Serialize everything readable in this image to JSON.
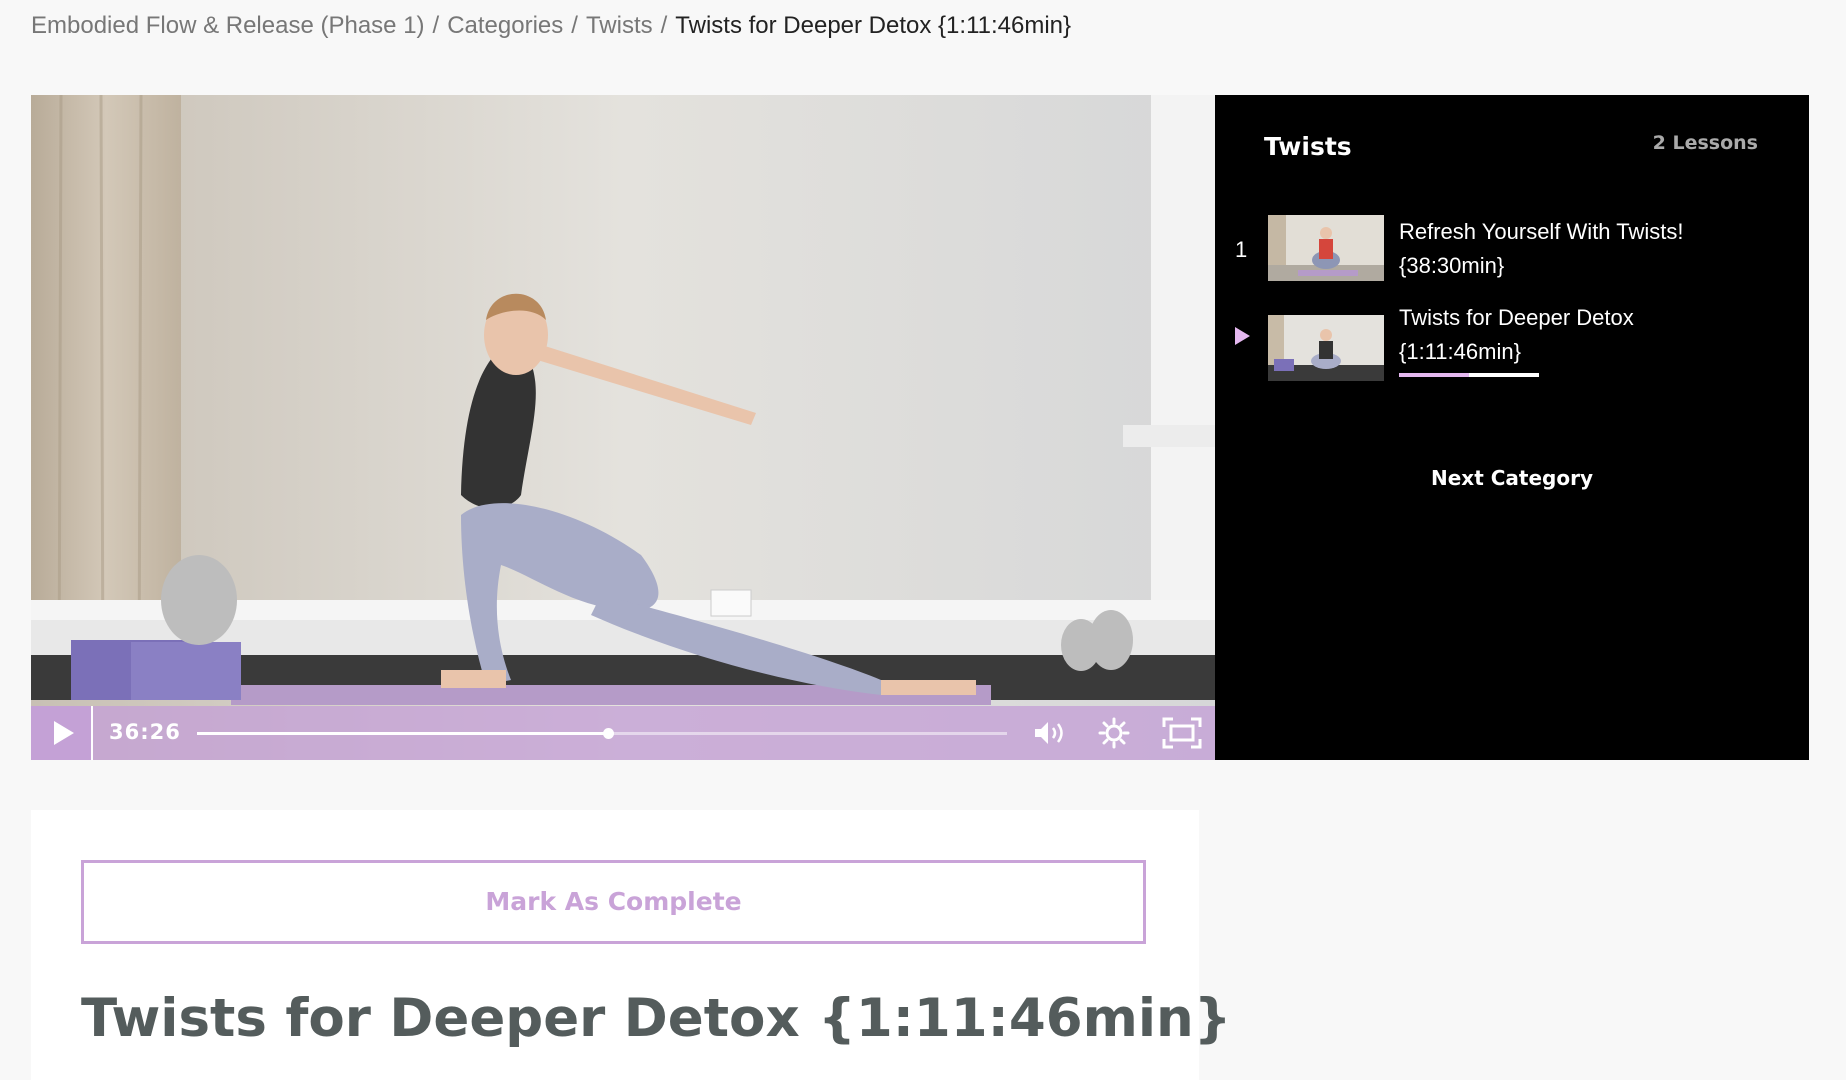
{
  "breadcrumb": {
    "course": "Embodied Flow & Release (Phase 1)",
    "categories": "Categories",
    "category": "Twists",
    "current": "Twists for Deeper Detox {1:11:46min}",
    "separator": "/"
  },
  "player": {
    "time": "36:26",
    "progress": 0.508,
    "accent": "#c4a0d6"
  },
  "sidebar": {
    "title": "Twists",
    "lesson_count": "2 Lessons",
    "lessons": [
      {
        "number": "1",
        "title": "Refresh Yourself With Twists! {38:30min}"
      },
      {
        "title": "Twists for Deeper Detox {1:11:46min}",
        "current": true,
        "progress": 0.5
      }
    ],
    "next_label": "Next Category"
  },
  "content": {
    "complete_label": "Mark As Complete",
    "title": "Twists for Deeper Detox {1:11:46min}"
  },
  "colors": {
    "accent": "#c9a3d8",
    "current_marker": "#e5b8f0",
    "sidebar_bg": "#000000",
    "title_text": "#545c5c"
  }
}
